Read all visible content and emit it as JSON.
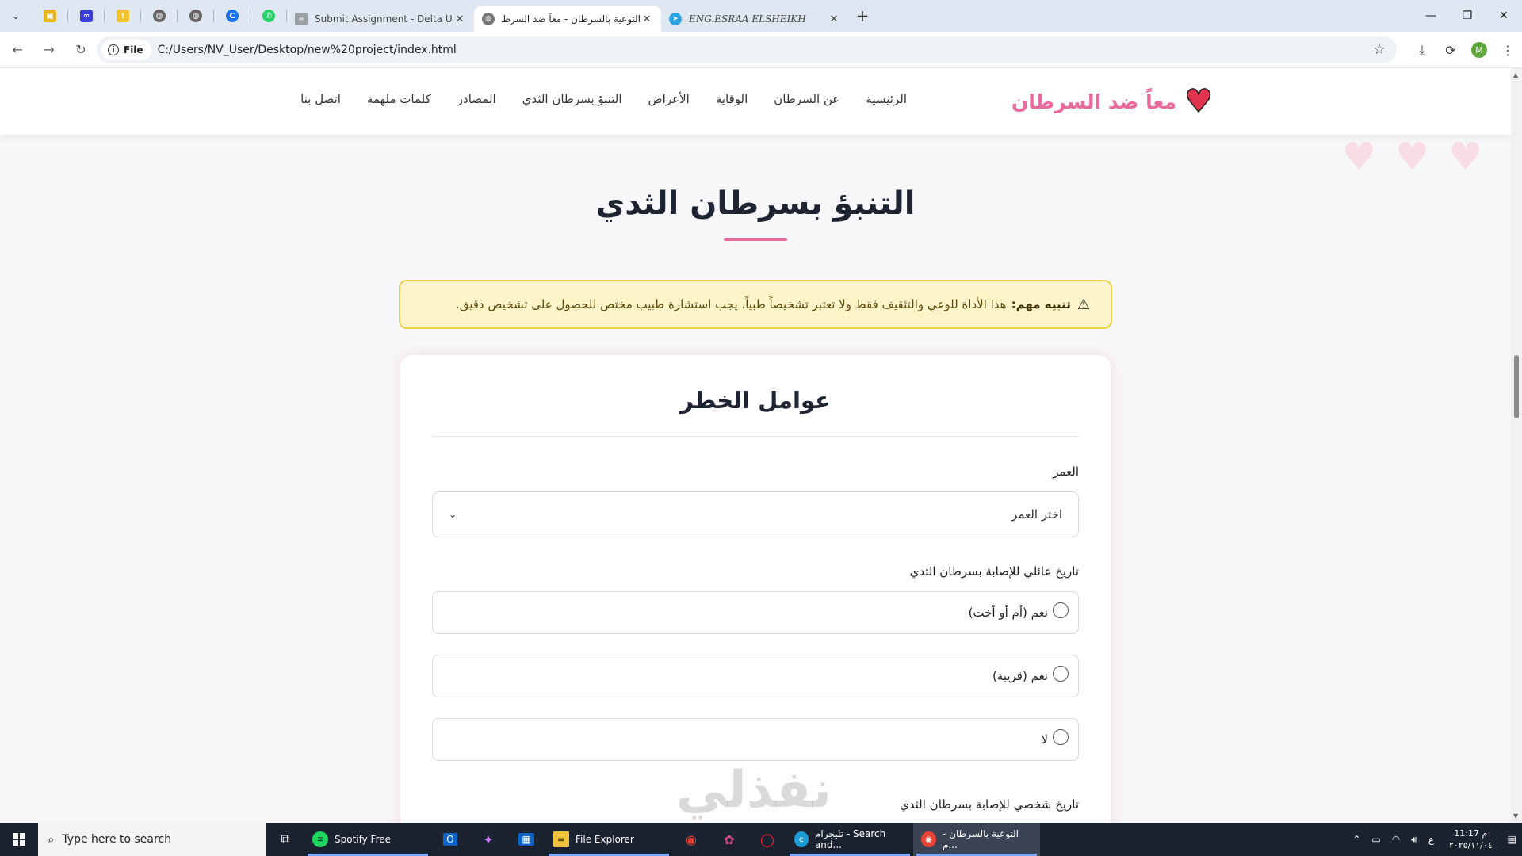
{
  "browser": {
    "tabs": [
      {
        "title": "Submit Assignment - Delta Uni",
        "active": false
      },
      {
        "title": "التوعية بالسرطان - معاً ضد السرطا",
        "active": true
      },
      {
        "title": "ENG.ESRAA ELSHEIKH",
        "active": false
      }
    ],
    "url_chip": "File",
    "url": "C:/Users/NV_User/Desktop/new%20project/index.html",
    "profile_initial": "M"
  },
  "site": {
    "brand_name": "معاً ضد السرطان",
    "nav": [
      "الرئيسية",
      "عن السرطان",
      "الوقاية",
      "الأعراض",
      "التنبؤ بسرطان الثدي",
      "المصادر",
      "كلمات ملهمة",
      "اتصل بنا"
    ]
  },
  "section": {
    "title": "التنبؤ بسرطان الثدي",
    "alert_label": "تنبيه مهم:",
    "alert_text": "هذا الأداة للوعي والتثقيف فقط ولا تعتبر تشخيصاً طبياً. يجب استشارة طبيب مختص للحصول على تشخيص دقيق."
  },
  "form": {
    "card_title": "عوامل الخطر",
    "age_label": "العمر",
    "age_value": "اختر العمر",
    "family_history_label": "تاريخ عائلي للإصابة بسرطان الثدي",
    "family_options": [
      "نعم (أم أو أخت)",
      "نعم (قريبة)",
      "لا"
    ],
    "personal_history_label": "تاريخ شخصي للإصابة بسرطان الثدي"
  },
  "watermark": "نفذلي",
  "taskbar": {
    "search_placeholder": "Type here to search",
    "apps": [
      "Spotify Free",
      "File Explorer",
      "تليجرام - Search and...",
      "التوعية بالسرطان - م..."
    ],
    "tray_lang": "ع",
    "time": "11:17 م",
    "date": "٢٠٢٥/١١/٠٤"
  }
}
